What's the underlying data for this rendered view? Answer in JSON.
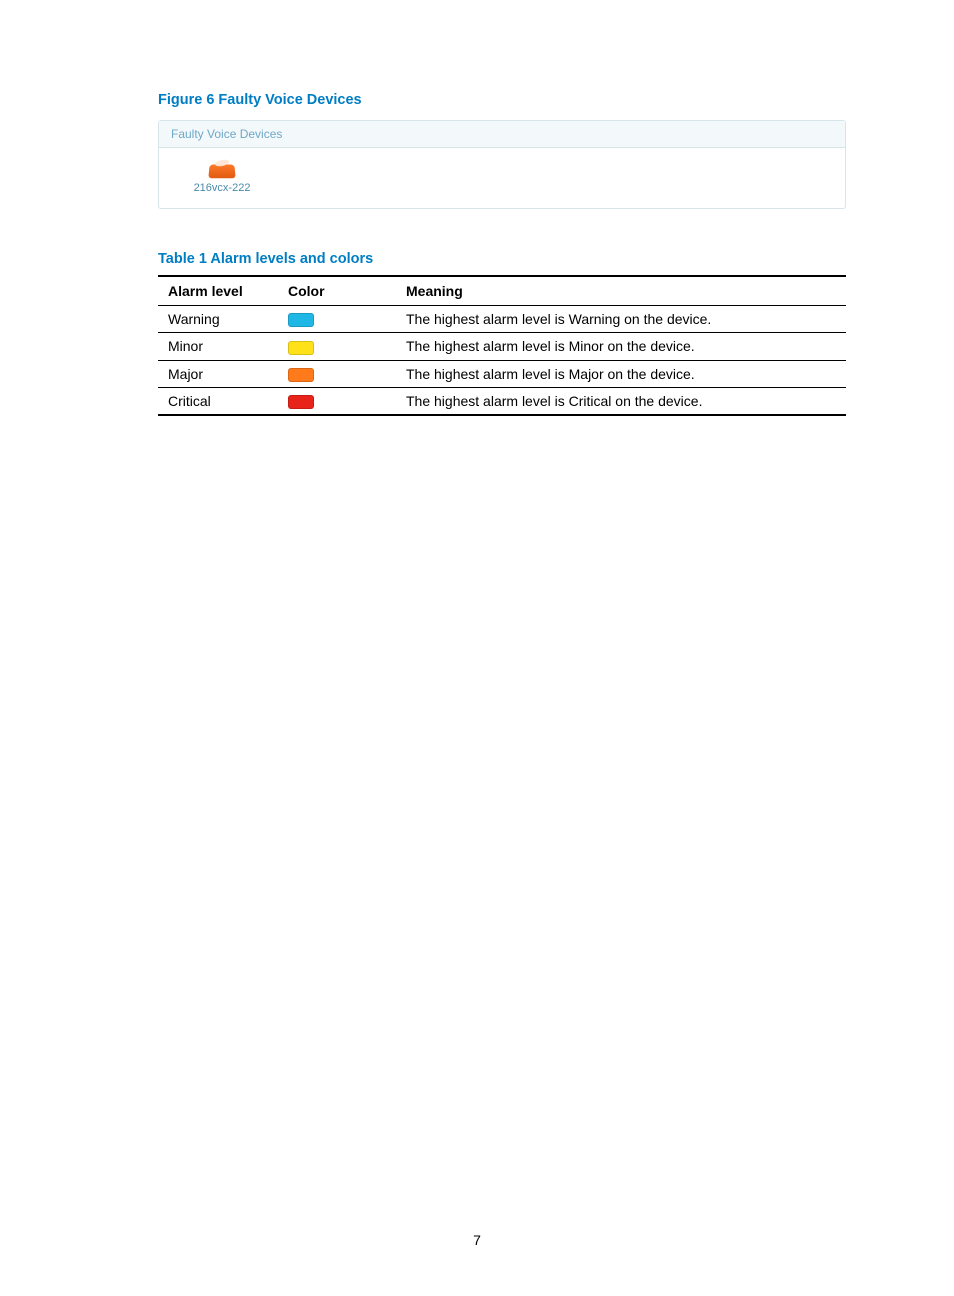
{
  "figure": {
    "title": "Figure 6 Faulty Voice Devices",
    "panel_header": "Faulty Voice Devices",
    "device_label": "216vcx-222"
  },
  "table": {
    "caption": "Table 1 Alarm levels and colors",
    "headers": {
      "level": "Alarm level",
      "color": "Color",
      "meaning": "Meaning"
    },
    "rows": [
      {
        "level": "Warning",
        "color": "#1fb7e6",
        "meaning": "The highest alarm level is Warning on the device."
      },
      {
        "level": "Minor",
        "color": "#ffe11a",
        "meaning": "The highest alarm level is Minor on the device."
      },
      {
        "level": "Major",
        "color": "#ff7a1a",
        "meaning": "The highest alarm level is Major on the device."
      },
      {
        "level": "Critical",
        "color": "#e8231a",
        "meaning": "The highest alarm level is Critical on the device."
      }
    ]
  },
  "page_number": "7"
}
